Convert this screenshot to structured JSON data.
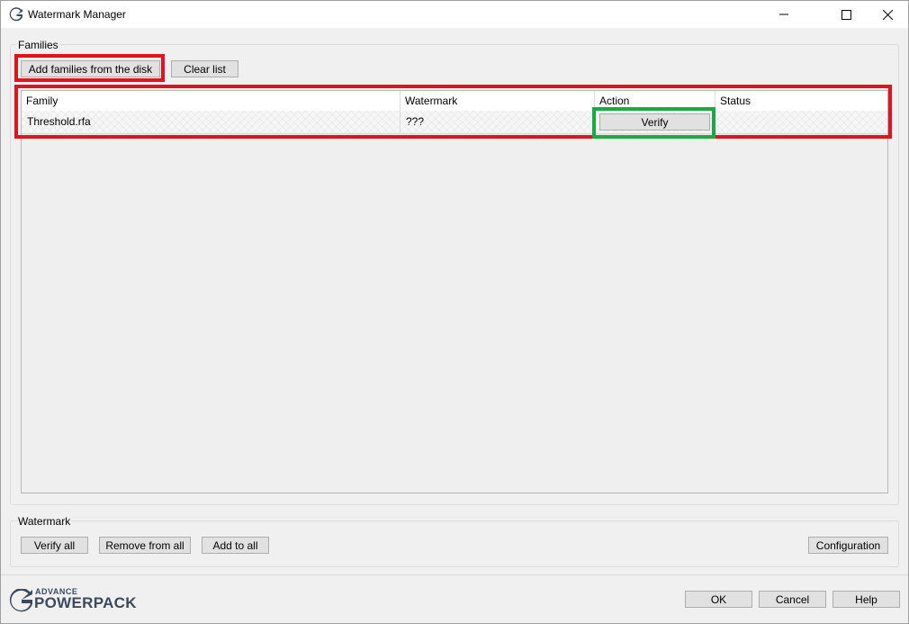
{
  "window": {
    "title": "Watermark Manager",
    "buttons": {
      "minimize_icon": "minimize-icon",
      "maximize_icon": "maximize-icon",
      "close_icon": "close-icon"
    }
  },
  "families": {
    "group_label": "Families",
    "add_button": "Add families from the disk",
    "clear_button": "Clear list",
    "table": {
      "columns": [
        "Family",
        "Watermark",
        "Action",
        "Status"
      ],
      "rows": [
        {
          "family": "Threshold.rfa",
          "watermark": "???",
          "action": "Verify",
          "status": ""
        }
      ]
    }
  },
  "watermark": {
    "group_label": "Watermark",
    "verify_all": "Verify all",
    "remove_from_all": "Remove from all",
    "add_to_all": "Add to all",
    "configuration": "Configuration"
  },
  "footer": {
    "logo_small": "ADVANCE",
    "logo_big": "POWERPACK",
    "ok": "OK",
    "cancel": "Cancel",
    "help": "Help"
  },
  "colors": {
    "highlight_red": "#e0141e",
    "highlight_green": "#1aab40",
    "logo_dark": "#3a4a5c"
  }
}
